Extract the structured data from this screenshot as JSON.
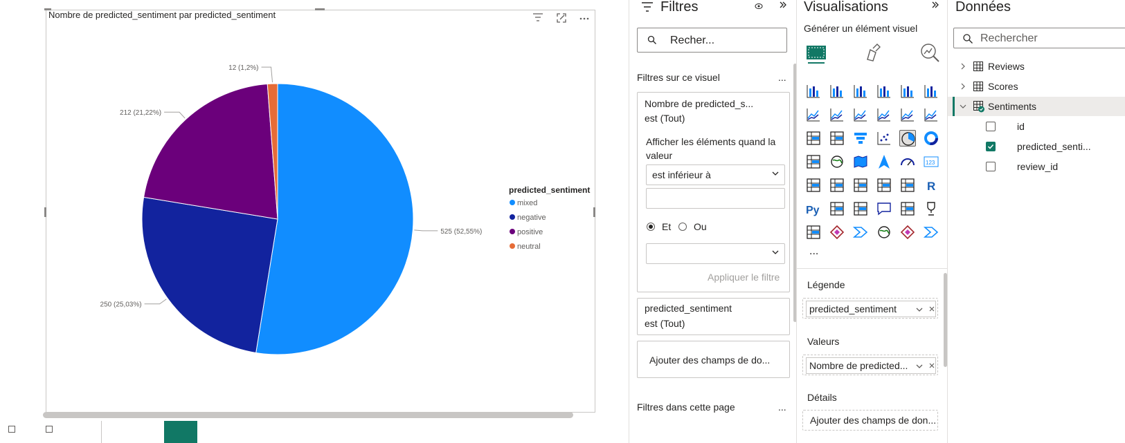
{
  "visual": {
    "title": "Nombre de predicted_sentiment par predicted_sentiment",
    "legend_title": "predicted_sentiment"
  },
  "chart_data": {
    "type": "pie",
    "title": "Nombre de predicted_sentiment par predicted_sentiment",
    "legend_title": "predicted_sentiment",
    "legend_position": "right",
    "slices": [
      {
        "label": "mixed",
        "value": 525,
        "percent_label": "525 (52,55%)",
        "color": "#118DFF"
      },
      {
        "label": "negative",
        "value": 250,
        "percent_label": "250 (25,03%)",
        "color": "#12239E"
      },
      {
        "label": "positive",
        "value": 212,
        "percent_label": "212 (21,22%)",
        "color": "#6B007B"
      },
      {
        "label": "neutral",
        "value": 12,
        "percent_label": "12 (1,2%)",
        "color": "#E66C37"
      }
    ]
  },
  "filters": {
    "title": "Filtres",
    "search_placeholder": "Recher...",
    "section_visual": "Filtres sur ce visuel",
    "section_more": "...",
    "card1": {
      "field": "Nombre de predicted_s...",
      "state": "est (Tout)",
      "show_items_label": "Afficher les éléments quand la valeur",
      "condition": "est inférieur à",
      "and_label": "Et",
      "or_label": "Ou",
      "apply_label": "Appliquer le filtre"
    },
    "card2": {
      "field": "predicted_sentiment",
      "state": "est (Tout)"
    },
    "add_fields": "Ajouter des champs de do...",
    "section_page": "Filtres dans cette page",
    "section_page_more": "..."
  },
  "visualisations": {
    "title": "Visualisations",
    "subtitle": "Générer un élément visuel",
    "more_label": "...",
    "wells": {
      "legend_label": "Légende",
      "legend_value": "predicted_sentiment",
      "values_label": "Valeurs",
      "values_value": "Nombre de predicted...",
      "details_label": "Détails",
      "details_value": "Ajouter des champs de don..."
    }
  },
  "data": {
    "title": "Données",
    "search_placeholder": "Rechercher",
    "tables": [
      {
        "name": "Reviews"
      },
      {
        "name": "Scores"
      },
      {
        "name": "Sentiments"
      }
    ],
    "fields": [
      {
        "name": "id",
        "checked": false
      },
      {
        "name": "predicted_senti...",
        "checked": true
      },
      {
        "name": "review_id",
        "checked": false
      }
    ]
  }
}
